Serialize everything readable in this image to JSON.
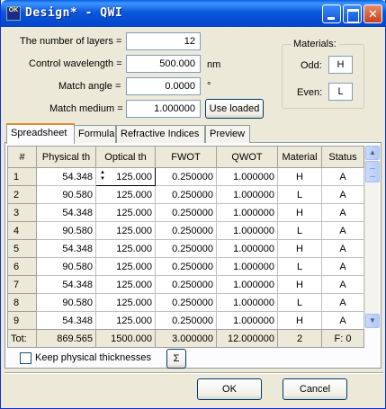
{
  "window": {
    "title": "Design* - QWI",
    "app_icon_text": "OK"
  },
  "form": {
    "layers_label": "The number of layers =",
    "layers_value": "12",
    "wavelength_label": "Control wavelength =",
    "wavelength_value": "500.000",
    "wavelength_unit": "nm",
    "angle_label": "Match angle =",
    "angle_value": "0.0000",
    "angle_unit": "°",
    "medium_label": "Match medium =",
    "medium_value": "1.000000",
    "use_loaded_label": "Use loaded"
  },
  "materials": {
    "title": "Materials:",
    "odd_label": "Odd:",
    "odd_value": "H",
    "even_label": "Even:",
    "even_value": "L"
  },
  "tabs": [
    {
      "label": "Spreadsheet",
      "active": true
    },
    {
      "label": "Formula",
      "active": false
    },
    {
      "label": "Refractive Indices",
      "active": false
    },
    {
      "label": "Preview",
      "active": false
    }
  ],
  "table": {
    "columns": [
      "#",
      "Physical th",
      "Optical th",
      "FWOT",
      "QWOT",
      "Material",
      "Status"
    ],
    "rows": [
      [
        "1",
        "54.348",
        "125.000",
        "0.250000",
        "1.000000",
        "H",
        "A"
      ],
      [
        "2",
        "90.580",
        "125.000",
        "0.250000",
        "1.000000",
        "L",
        "A"
      ],
      [
        "3",
        "54.348",
        "125.000",
        "0.250000",
        "1.000000",
        "H",
        "A"
      ],
      [
        "4",
        "90.580",
        "125.000",
        "0.250000",
        "1.000000",
        "L",
        "A"
      ],
      [
        "5",
        "54.348",
        "125.000",
        "0.250000",
        "1.000000",
        "H",
        "A"
      ],
      [
        "6",
        "90.580",
        "125.000",
        "0.250000",
        "1.000000",
        "L",
        "A"
      ],
      [
        "7",
        "54.348",
        "125.000",
        "0.250000",
        "1.000000",
        "H",
        "A"
      ],
      [
        "8",
        "90.580",
        "125.000",
        "0.250000",
        "1.000000",
        "L",
        "A"
      ],
      [
        "9",
        "54.348",
        "125.000",
        "0.250000",
        "1.000000",
        "H",
        "A"
      ]
    ],
    "totals": [
      "Tot:",
      "869.565",
      "1500.000",
      "3.000000",
      "12.000000",
      "2",
      "F: 0"
    ]
  },
  "options": {
    "keep_physical_label": "Keep physical thicknesses",
    "sigma_label": "Σ"
  },
  "footer": {
    "ok_label": "OK",
    "cancel_label": "Cancel"
  }
}
